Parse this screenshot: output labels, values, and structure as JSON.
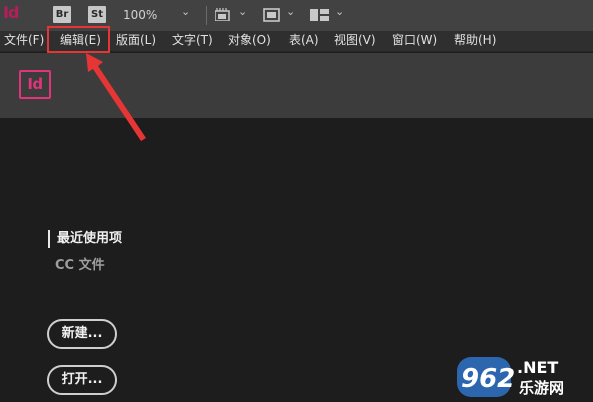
{
  "toolbar": {
    "app_logo": "Id",
    "bridge_label": "Br",
    "stock_label": "St",
    "zoom_value": "100%",
    "icons": [
      "view-options-icon",
      "screen-mode-icon",
      "arrange-documents-icon",
      "chevron-down-icon"
    ]
  },
  "menubar": {
    "items": [
      {
        "label": "文件(F)"
      },
      {
        "label": "编辑(E)"
      },
      {
        "label": "版面(L)"
      },
      {
        "label": "文字(T)"
      },
      {
        "label": "对象(O)"
      },
      {
        "label": "表(A)"
      },
      {
        "label": "视图(V)"
      },
      {
        "label": "窗口(W)"
      },
      {
        "label": "帮助(H)"
      }
    ]
  },
  "welcome": {
    "logo": "Id",
    "nav": {
      "recent": "最近使用项",
      "cc_files": "CC 文件"
    },
    "buttons": {
      "new": "新建...",
      "open": "打开..."
    }
  },
  "watermark": {
    "number": "962",
    "suffix": ".NET",
    "site": "乐游网"
  },
  "colors": {
    "brand": "#e0347b",
    "highlight": "#e53535",
    "toolbar_bg": "#424242",
    "menubar_bg": "#2f2f2f",
    "header_bg": "#3c3c3c",
    "body_bg": "#1d1d1d"
  }
}
